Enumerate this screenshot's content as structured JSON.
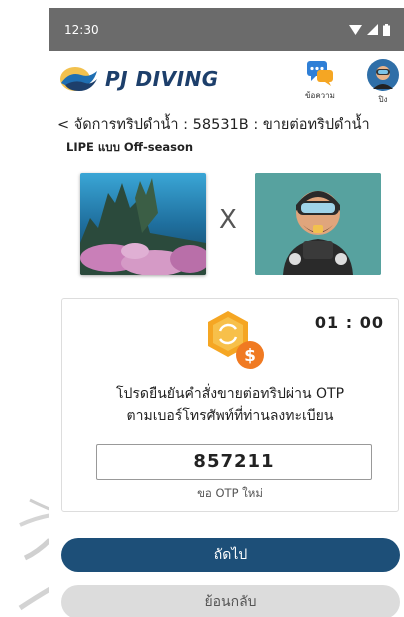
{
  "status_bar": {
    "time": "12:30"
  },
  "header": {
    "brand": "PJ DIVING",
    "messages_label": "ข้อความ",
    "profile_label": "ปิง"
  },
  "breadcrumb": "< จัดการทริปดำน้ำ : 58531B : ขายต่อทริปดำน้ำ",
  "trip": {
    "name": "LIPE แบบ Off-season",
    "separator": "X"
  },
  "otp": {
    "timer": "01 : 00",
    "instruction_line1": "โปรดยืนยันคำสั่งขายต่อทริปผ่าน OTP",
    "instruction_line2": "ตามเบอร์โทรศัพท์ที่ท่านลงทะเบียน",
    "code": "857211",
    "resend_label": "ขอ OTP ใหม่"
  },
  "actions": {
    "next_label": "ถัดไป",
    "back_label": "ย้อนกลับ"
  },
  "colors": {
    "primary": "#1d4f78",
    "status_bar": "#6b6b6b",
    "brand_text": "#1d3f6b",
    "coin": "#f5a623",
    "avatar_bg": "#57a29f"
  },
  "icons": {
    "wifi": "wifi-icon",
    "signal": "signal-icon",
    "battery": "battery-icon",
    "messages": "chat-icon",
    "profile": "diver-avatar-icon",
    "coin": "coin-swap-icon"
  }
}
